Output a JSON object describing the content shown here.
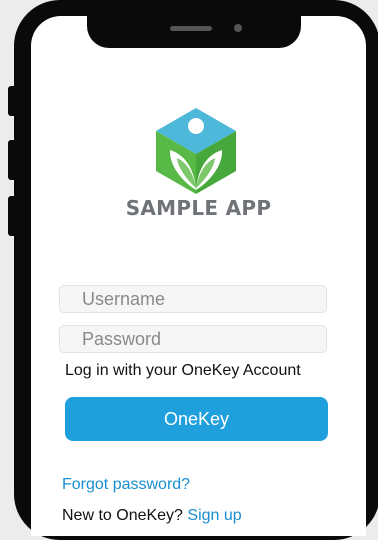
{
  "app": {
    "title": "SAMPLE APP",
    "logo_icon": "hexagon-leaf-logo-icon",
    "colors": {
      "logo_blue": "#4db8d9",
      "logo_green": "#58b947",
      "accent": "#1fa0dc",
      "link": "#1a8fd0"
    }
  },
  "form": {
    "username_placeholder": "Username",
    "password_placeholder": "Password",
    "login_hint": "Log in with your OneKey Account",
    "submit_label": "OneKey"
  },
  "links": {
    "forgot_password": "Forgot password?",
    "new_prompt": "New to OneKey?",
    "sign_up": "Sign up"
  }
}
